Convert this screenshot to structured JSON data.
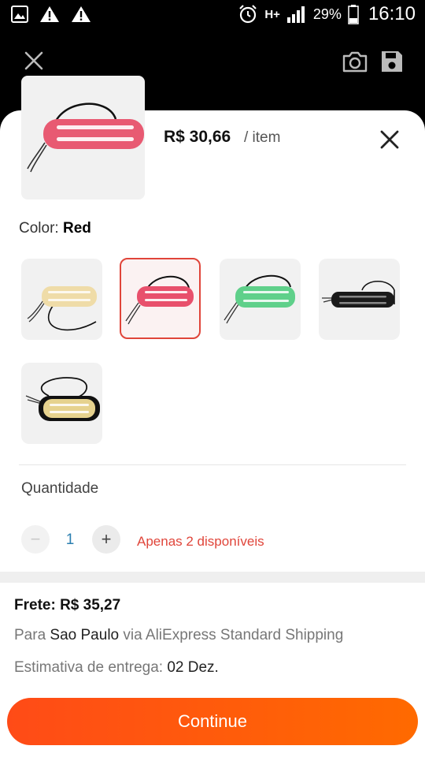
{
  "status_bar": {
    "battery_percent": "29%",
    "time": "16:10",
    "network": "H+",
    "left_icons": [
      "image-icon",
      "warning-icon",
      "warning-icon"
    ]
  },
  "top_bar": {
    "icons": [
      "close-icon",
      "camera-icon",
      "save-icon"
    ]
  },
  "product": {
    "price": "R$ 30,66",
    "per_item": "/ item",
    "thumbnail_color": "#e85a72"
  },
  "color": {
    "label": "Color:",
    "selected": "Red",
    "options": [
      {
        "name": "Cream",
        "color": "#efdca8",
        "selected": false
      },
      {
        "name": "Red",
        "color": "#e8506c",
        "selected": true
      },
      {
        "name": "Green",
        "color": "#5fd08a",
        "selected": false
      },
      {
        "name": "Black",
        "color": "#1b1b1b",
        "selected": false
      },
      {
        "name": "Gold",
        "color": "#e6d28e",
        "selected": false
      }
    ]
  },
  "quantity": {
    "label": "Quantidade",
    "value": "1",
    "minus": "−",
    "plus": "+",
    "stock_note": "Apenas 2 disponíveis"
  },
  "shipping": {
    "title": "Frete: R$ 35,27",
    "route_prefix": "Para ",
    "city": "Sao Paulo",
    "route_suffix": " via AliExpress Standard Shipping",
    "eta_prefix": "Estimativa de entrega: ",
    "eta_date": "02 Dez."
  },
  "continue_label": "Continue",
  "colors": {
    "accent": "#ff5a10",
    "stock_red": "#e0453a",
    "qty_blue": "#2b7fb0"
  }
}
